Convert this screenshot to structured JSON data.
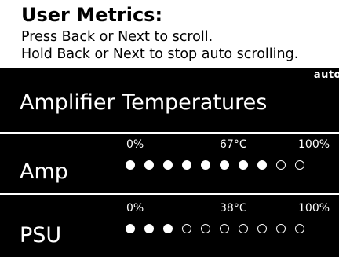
{
  "header": {
    "title": "User Metrics:",
    "instruction_1": "Press Back or Next to scroll.",
    "instruction_2": "Hold Back or Next to stop auto scrolling."
  },
  "section": {
    "auto_label": "auto",
    "title": "Amplifier Temperatures"
  },
  "metrics": [
    {
      "label": "Amp",
      "min_label": "0%",
      "max_label": "100%",
      "value_label": "67°C",
      "filled_dots": 8,
      "total_dots": 10
    },
    {
      "label": "PSU",
      "min_label": "0%",
      "max_label": "100%",
      "value_label": "38°C",
      "filled_dots": 3,
      "total_dots": 10
    }
  ],
  "colors": {
    "panel_bg": "#000000",
    "panel_fg": "#ffffff",
    "header_bg": "#ffffff",
    "header_fg": "#000000"
  }
}
